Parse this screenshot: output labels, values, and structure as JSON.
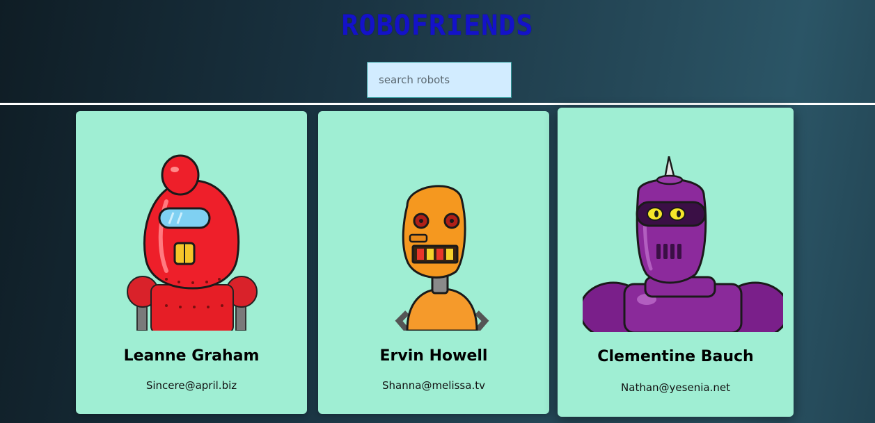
{
  "header": {
    "title": "ROBOFRIENDS"
  },
  "search": {
    "placeholder": "search robots",
    "value": ""
  },
  "colors": {
    "title": "#1412c9",
    "search_bg": "#d2ecff",
    "card_bg": "#9feed3",
    "divider": "#ffffff"
  },
  "robots": [
    {
      "name": "Leanne Graham",
      "email": "Sincere@april.biz",
      "avatar": "red-robot-avatar"
    },
    {
      "name": "Ervin Howell",
      "email": "Shanna@melissa.tv",
      "avatar": "orange-robot-avatar"
    },
    {
      "name": "Clementine Bauch",
      "email": "Nathan@yesenia.net",
      "avatar": "purple-robot-avatar"
    }
  ]
}
